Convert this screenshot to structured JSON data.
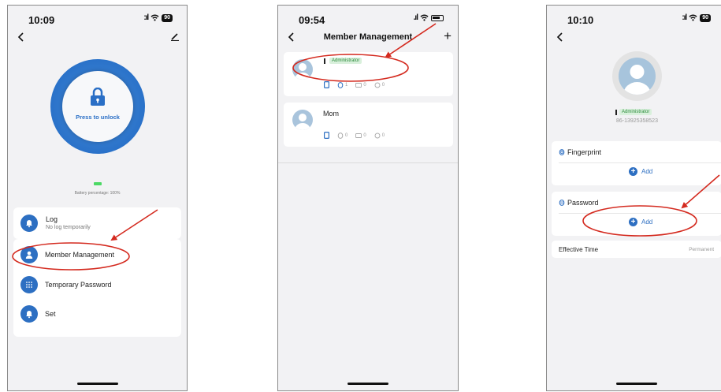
{
  "screen1": {
    "time": "10:09",
    "battery": "90",
    "unlock_label": "Press to unlock",
    "battery_text": "Battery percentage: 100%",
    "log_title": "Log",
    "log_sub": "No log temporarily",
    "menu": [
      "Member Management",
      "Temporary Password",
      "Set"
    ]
  },
  "screen2": {
    "time": "09:54",
    "title": "Member Management",
    "admin_badge": "Administrator",
    "member2_name": "Mom",
    "counts": [
      "0",
      "0",
      "0"
    ],
    "counts_admin": [
      "1",
      "0",
      "0"
    ]
  },
  "screen3": {
    "time": "10:10",
    "battery": "90",
    "admin_badge": "Administrator",
    "phone": "86-13925358523",
    "fingerprint_label": "Fingerprint",
    "password_label": "Password",
    "add_label": "Add",
    "effective_label": "Effective Time",
    "effective_value": "Permanent"
  },
  "colors": {
    "accent": "#2d6fc2",
    "annotation": "#d42a1f",
    "badge_text": "#2a8a3a",
    "badge_bg": "#d9f0dc"
  }
}
